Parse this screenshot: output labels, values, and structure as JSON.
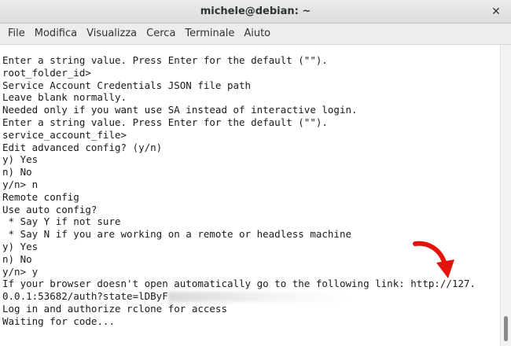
{
  "window": {
    "title": "michele@debian: ~",
    "close_glyph": "✕"
  },
  "menu": [
    "File",
    "Modifica",
    "Visualizza",
    "Cerca",
    "Terminale",
    "Aiuto"
  ],
  "terminal": {
    "lines": [
      "Enter a string value. Press Enter for the default (\"\").",
      "root_folder_id>",
      "Service Account Credentials JSON file path",
      "Leave blank normally.",
      "Needed only if you want use SA instead of interactive login.",
      "Enter a string value. Press Enter for the default (\"\").",
      "service_account_file>",
      "Edit advanced config? (y/n)",
      "y) Yes",
      "n) No",
      "y/n> n",
      "Remote config",
      "Use auto config?",
      " * Say Y if not sure",
      " * Say N if you are working on a remote or headless machine",
      "y) Yes",
      "n) No",
      "y/n> y",
      "If your browser doesn't open automatically go to the following link: http://127.",
      "0.0.1:53682/auth?state=lDByF",
      "Log in and authorize rclone for access",
      "Waiting for code..."
    ]
  },
  "colors": {
    "annotation_arrow": "#e3120b"
  }
}
